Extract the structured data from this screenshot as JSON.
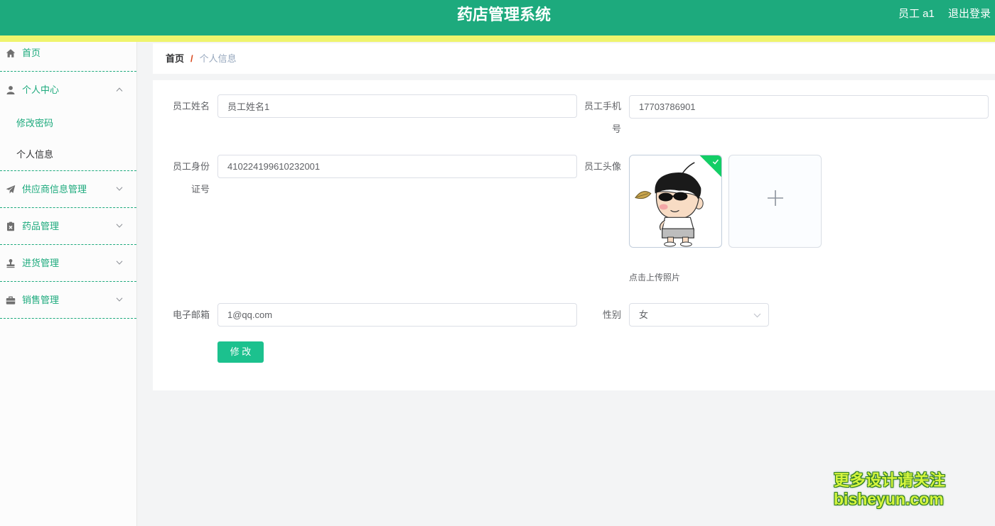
{
  "header": {
    "title": "药店管理系统",
    "user_label": "员工 a1",
    "logout_label": "退出登录"
  },
  "theme": {
    "primary": "#1daa7d",
    "stripe": "#eff46d",
    "button": "#1cc18e",
    "breadcrumb_separator": "#d9481c",
    "upload_success": "#13ce66"
  },
  "sidebar": {
    "items": [
      {
        "label": "首页",
        "icon": "home-icon"
      },
      {
        "label": "个人中心",
        "icon": "user-icon",
        "expanded": true,
        "children": [
          {
            "label": "修改密码",
            "active": false
          },
          {
            "label": "个人信息",
            "active": true
          }
        ]
      },
      {
        "label": "供应商信息管理",
        "icon": "paper-plane-icon",
        "expanded": false
      },
      {
        "label": "药品管理",
        "icon": "clipboard-icon",
        "expanded": false
      },
      {
        "label": "进货管理",
        "icon": "stamp-icon",
        "expanded": false
      },
      {
        "label": "销售管理",
        "icon": "briefcase-icon",
        "expanded": false
      }
    ]
  },
  "breadcrumb": {
    "items": [
      "首页",
      "个人信息"
    ],
    "separator": "/"
  },
  "form": {
    "name": {
      "label": "员工姓名",
      "value": "员工姓名1"
    },
    "phone": {
      "label": "员工手机号",
      "value": "17703786901"
    },
    "id_card": {
      "label": "员工身份证号",
      "value": "410224199610232001"
    },
    "avatar": {
      "label": "员工头像",
      "tip": "点击上传照片",
      "uploaded": true
    },
    "email": {
      "label": "电子邮箱",
      "value": "1@qq.com"
    },
    "gender": {
      "label": "性别",
      "value": "女"
    },
    "submit_label": "修 改"
  },
  "watermark": {
    "lines": [
      "更多设计请关注",
      "bisheyun.com"
    ]
  }
}
